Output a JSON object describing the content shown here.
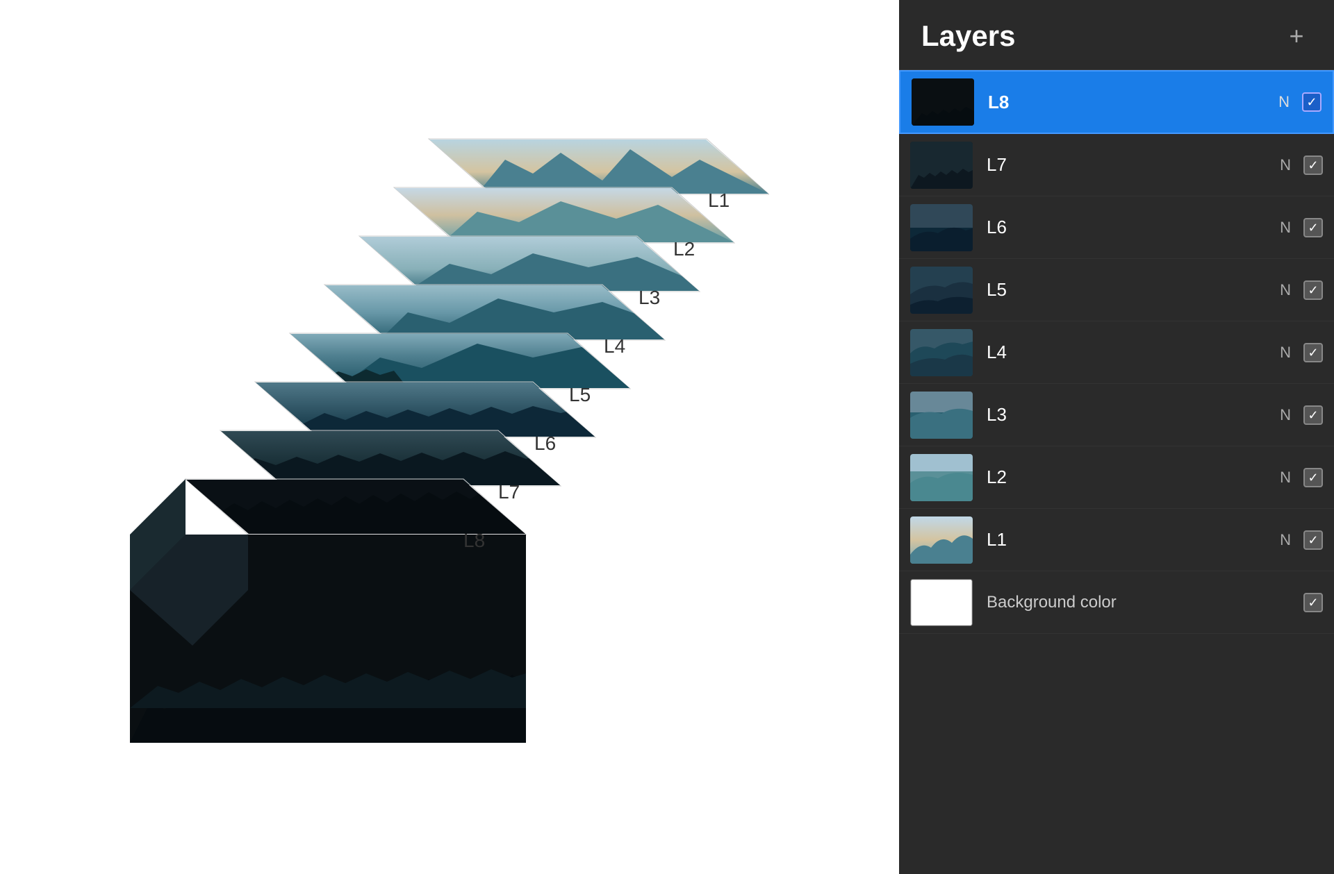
{
  "panel": {
    "title": "Layers",
    "add_button": "+",
    "layers": [
      {
        "id": "L8",
        "name": "L8",
        "blend": "N",
        "checked": true,
        "active": true,
        "thumb_type": "l8"
      },
      {
        "id": "L7",
        "name": "L7",
        "blend": "N",
        "checked": true,
        "active": false,
        "thumb_type": "l7"
      },
      {
        "id": "L6",
        "name": "L6",
        "blend": "N",
        "checked": true,
        "active": false,
        "thumb_type": "l6"
      },
      {
        "id": "L5",
        "name": "L5",
        "blend": "N",
        "checked": true,
        "active": false,
        "thumb_type": "l5"
      },
      {
        "id": "L4",
        "name": "L4",
        "blend": "N",
        "checked": true,
        "active": false,
        "thumb_type": "l4"
      },
      {
        "id": "L3",
        "name": "L3",
        "blend": "N",
        "checked": true,
        "active": false,
        "thumb_type": "l3"
      },
      {
        "id": "L2",
        "name": "L2",
        "blend": "N",
        "checked": true,
        "active": false,
        "thumb_type": "l2"
      },
      {
        "id": "L1",
        "name": "L1",
        "blend": "N",
        "checked": true,
        "active": false,
        "thumb_type": "l1"
      },
      {
        "id": "bg",
        "name": "Background color",
        "blend": "",
        "checked": true,
        "active": false,
        "thumb_type": "bg"
      }
    ]
  },
  "illustration": {
    "labels": [
      "L1",
      "L2",
      "L3",
      "L4",
      "L5",
      "L6",
      "L7",
      "L8"
    ]
  }
}
